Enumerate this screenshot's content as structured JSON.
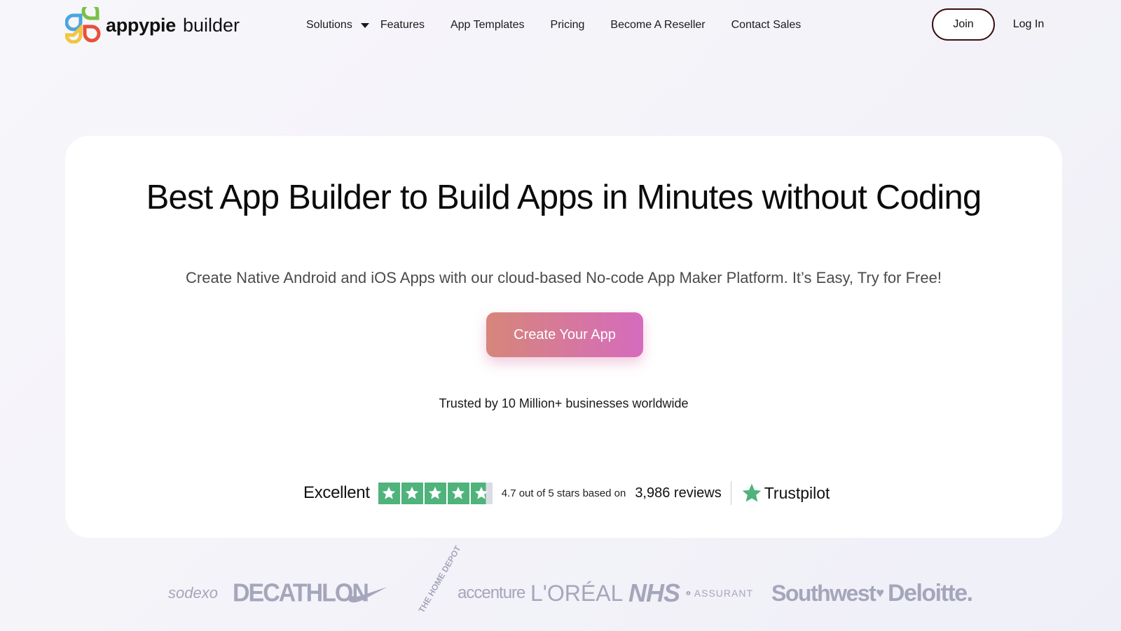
{
  "brand": {
    "name": "appypie",
    "suffix": "builder",
    "colors": {
      "green": "#7cc043",
      "blue": "#4aa6e0",
      "yellow": "#f2c53d",
      "red": "#e8503a"
    }
  },
  "nav": {
    "items": [
      {
        "label": "Solutions",
        "has_dropdown": true
      },
      {
        "label": "Features"
      },
      {
        "label": "App Templates"
      },
      {
        "label": "Pricing"
      },
      {
        "label": "Become A Reseller"
      },
      {
        "label": "Contact Sales"
      }
    ],
    "join_label": "Join",
    "login_label": "Log In"
  },
  "hero": {
    "title": "Best App Builder to Build Apps in Minutes without Coding",
    "subtitle": "Create Native Android and iOS Apps with our cloud-based No-code App Maker Platform. It’s Easy, Try for Free!",
    "cta_label": "Create Your App",
    "trusted": "Trusted by 10 Million+ businesses worldwide",
    "cta_gradient": [
      "#d6867a",
      "#d66bbd"
    ]
  },
  "trustpilot": {
    "rating_word": "Excellent",
    "stars_filled": 4.7,
    "stars_total": 5,
    "score_text": "4.7 out of 5 stars based on",
    "reviews_text": "3,986 reviews",
    "brand": "Trustpilot",
    "star_color": "#4fb37b"
  },
  "clients": {
    "color": "#a5a6bb",
    "logos": [
      {
        "name": "sodexo",
        "text": "sodexo"
      },
      {
        "name": "decathlon",
        "text": "DECATHLON"
      },
      {
        "name": "nike",
        "text": ""
      },
      {
        "name": "home-depot",
        "text": "THE HOME DEPOT"
      },
      {
        "name": "accenture",
        "text": "accenture"
      },
      {
        "name": "loreal",
        "text": "L'ORÉAL"
      },
      {
        "name": "nhs",
        "text": "NHS"
      },
      {
        "name": "assurant",
        "text": "ASSURANT"
      },
      {
        "name": "southwest",
        "text": "Southwest"
      },
      {
        "name": "deloitte",
        "text": "Deloitte."
      }
    ]
  }
}
